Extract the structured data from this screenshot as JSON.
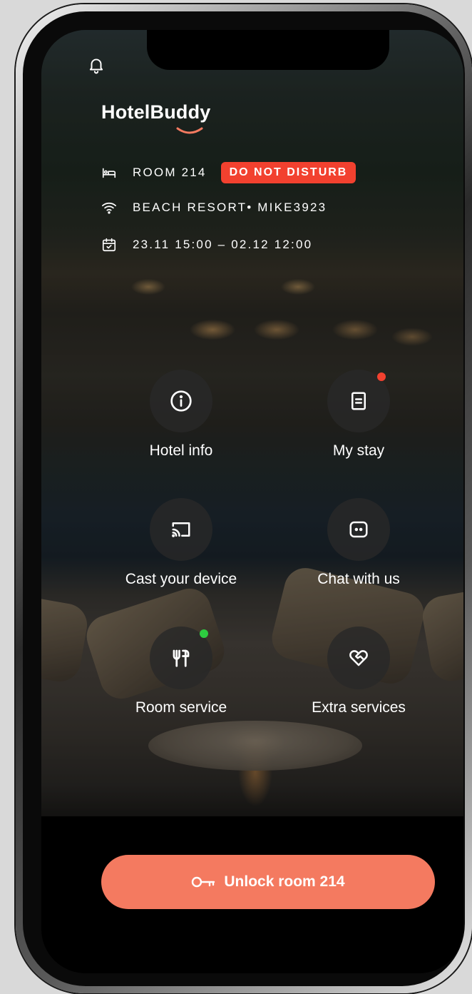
{
  "app": {
    "brand_prefix": "HotelBu",
    "brand_highlight": "dd",
    "brand_suffix": "y",
    "accent_color": "#f47a60",
    "badge_color": "#f2412f"
  },
  "header": {
    "notification_icon": "bell-icon",
    "room_label": "ROOM 214",
    "dnd_label": "DO NOT DISTURB",
    "wifi_label": "BEACH RESORT• MIKE3923",
    "dates_label": "23.11 15:00 – 02.12 12:00"
  },
  "tiles": [
    {
      "label": "Hotel info",
      "icon": "info-icon"
    },
    {
      "label": "My stay",
      "icon": "document-icon",
      "badge_color": "#f2412f"
    },
    {
      "label": "Cast your device",
      "icon": "cast-icon"
    },
    {
      "label": "Chat with us",
      "icon": "chat-bot-icon"
    },
    {
      "label": "Room service",
      "icon": "cutlery-icon",
      "badge_color": "#2ecc40"
    },
    {
      "label": "Extra services",
      "icon": "heart-handshake-icon"
    }
  ],
  "unlock_button": {
    "label": "Unlock room 214",
    "icon": "key-icon"
  }
}
